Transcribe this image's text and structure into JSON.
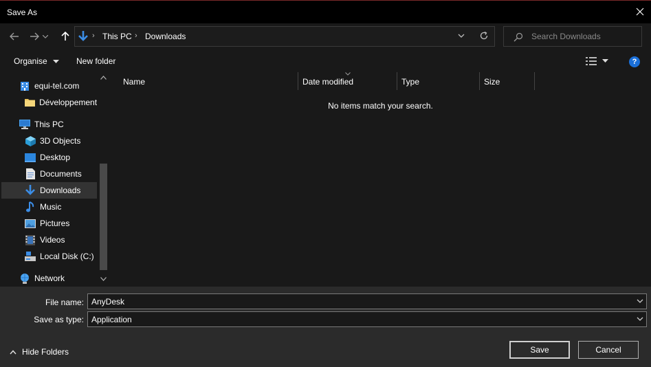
{
  "window": {
    "title": "Save As"
  },
  "navigation": {
    "breadcrumb": [
      "This PC",
      "Downloads"
    ],
    "search_placeholder": "Search Downloads"
  },
  "command_bar": {
    "organise": "Organise",
    "new_folder": "New folder",
    "help": "?"
  },
  "nav_pane": {
    "items": [
      {
        "label": "equi-tel.com",
        "icon": "building-icon"
      },
      {
        "label": "Développement",
        "icon": "folder-icon"
      },
      {
        "label": "This PC",
        "icon": "computer-icon"
      },
      {
        "label": "3D Objects",
        "icon": "cube-icon"
      },
      {
        "label": "Desktop",
        "icon": "desktop-icon"
      },
      {
        "label": "Documents",
        "icon": "document-icon"
      },
      {
        "label": "Downloads",
        "icon": "download-arrow-icon",
        "selected": true
      },
      {
        "label": "Music",
        "icon": "music-note-icon"
      },
      {
        "label": "Pictures",
        "icon": "picture-icon"
      },
      {
        "label": "Videos",
        "icon": "film-icon"
      },
      {
        "label": "Local Disk (C:)",
        "icon": "drive-icon"
      },
      {
        "label": "Network",
        "icon": "network-icon"
      }
    ]
  },
  "content": {
    "columns": [
      "Name",
      "Date modified",
      "Type",
      "Size"
    ],
    "empty_message": "No items match your search."
  },
  "form": {
    "file_name_label": "File name:",
    "file_name_value": "AnyDesk",
    "save_type_label": "Save as type:",
    "save_type_value": "Application"
  },
  "footer": {
    "hide_folders": "Hide Folders",
    "save": "Save",
    "cancel": "Cancel"
  },
  "colors": {
    "background": "#191919",
    "bottom_panel": "#2b2b2b",
    "accent_blue": "#1a6fd8"
  }
}
